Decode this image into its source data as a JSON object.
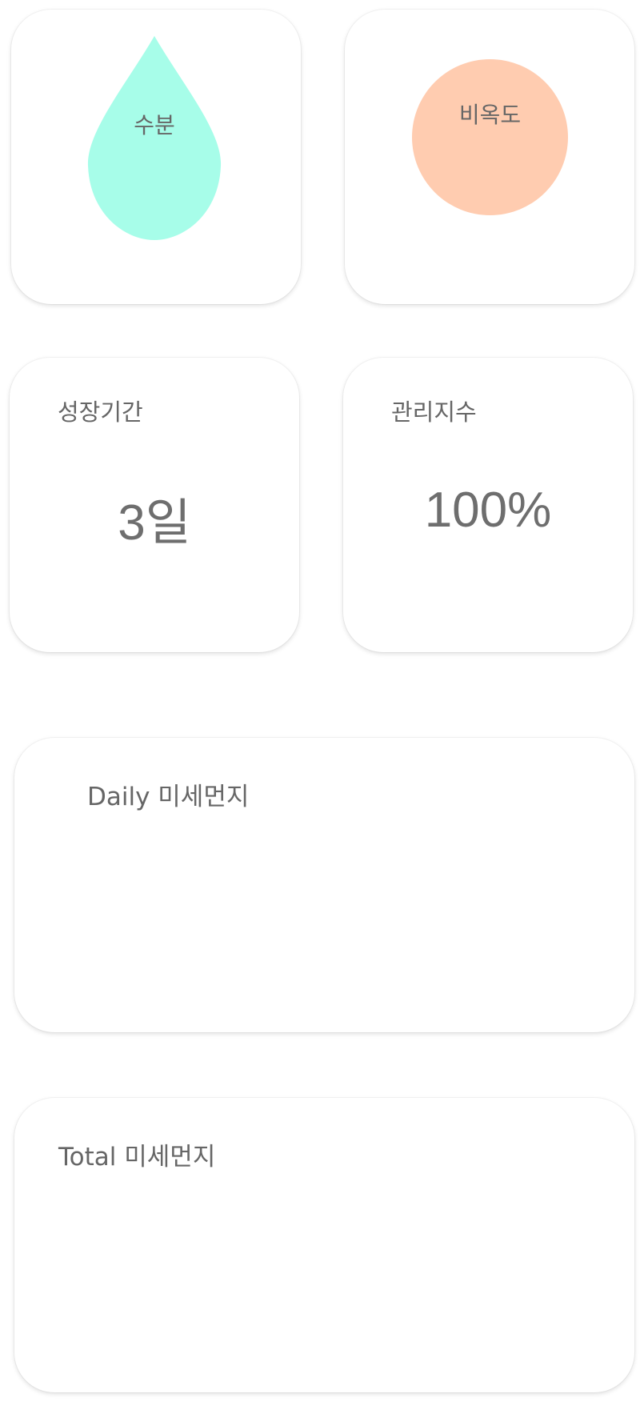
{
  "gauges": {
    "water": {
      "label": "수분",
      "color": "#a7fde9",
      "icon": "water-drop-icon"
    },
    "fertility": {
      "label": "비옥도",
      "color": "#ffccb0",
      "icon": "circle-icon"
    }
  },
  "stats": {
    "growth": {
      "title": "성장기간",
      "value": "3일"
    },
    "care": {
      "title": "관리지수",
      "value": "100%"
    }
  },
  "charts": {
    "daily": {
      "title": "Daily 미세먼지"
    },
    "total": {
      "title": "Total 미세먼지"
    }
  }
}
